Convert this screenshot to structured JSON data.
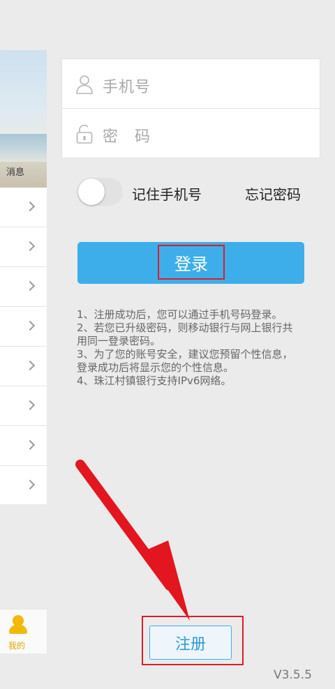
{
  "drawer": {
    "banner_label": "消息",
    "rows": 8,
    "tab_label": "我的"
  },
  "login_form": {
    "phone_placeholder": "手机号",
    "password_placeholder": "密码"
  },
  "remember": {
    "label": "记住手机号",
    "checked": false
  },
  "forgot_password": "忘记密码",
  "login_button": "登录",
  "notes": [
    "1、注册成功后，您可以通过手机号码登录。",
    "2、若您已升级密码，则移动银行与网上银行共用同一登录密码。",
    "3、为了您的账号安全，建议您预留个性信息，登录成功后将显示您的个性信息。",
    "4、珠江村镇银行支持IPv6网络。"
  ],
  "register_button": "注册",
  "version": "V3.5.5",
  "colors": {
    "accent": "#3daee9",
    "annotation": "#d6202b",
    "background": "#ebebeb"
  }
}
